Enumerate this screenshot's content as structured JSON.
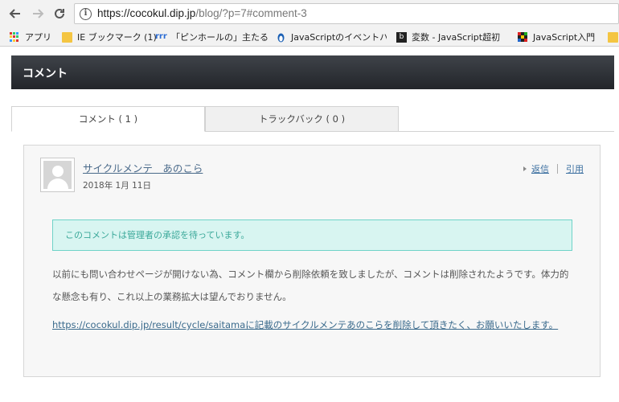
{
  "browser": {
    "url_host": "https://cocokul.dip.jp",
    "url_rest": "/blog/?p=7#comment-3",
    "bookmarks": [
      {
        "label": "アプリ",
        "icon": "apps-grid-icon"
      },
      {
        "label": "IE ブックマーク (1)",
        "icon": "folder-icon"
      },
      {
        "label": "「ピンホールの」主たる原因",
        "icon": "site-favicon"
      },
      {
        "label": "JavaScriptのイベントハン",
        "icon": "penguin-favicon"
      },
      {
        "label": "変数 - JavaScript超初",
        "icon": "book-favicon"
      },
      {
        "label": "JavaScript入門",
        "icon": "grid-favicon"
      }
    ]
  },
  "section": {
    "title": "コメント"
  },
  "tabs": [
    {
      "label": "コメント ( 1 )",
      "active": true
    },
    {
      "label": "トラックバック ( 0 )",
      "active": false
    }
  ],
  "comment": {
    "author": "サイクルメンテ　あのこら",
    "date": "2018年 1月 11日",
    "reply_label": "返信",
    "quote_label": "引用",
    "notice": "このコメントは管理者の承認を待っています。",
    "body": "以前にも問い合わせページが開けない為、コメント欄から削除依頼を致しましたが、コメントは削除されたようです。体力的な懸念も有り、これ以上の業務拡大は望んでおりません。",
    "link": "https://cocokul.dip.jp/result/cycle/saitamaに記載のサイクルメンテあのこらを削除して頂きたく、お願いいたします。"
  }
}
